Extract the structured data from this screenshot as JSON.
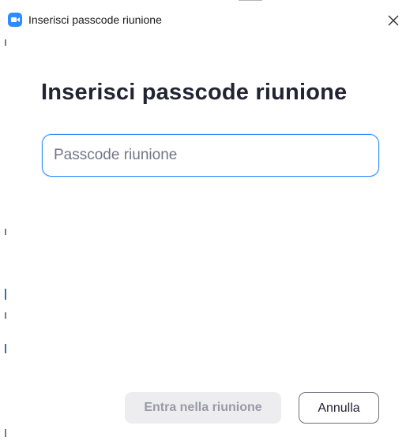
{
  "window": {
    "title": "Inserisci passcode riunione",
    "close_icon": "close-icon",
    "app_icon": "zoom-app-icon",
    "accent_color": "#2d8cff"
  },
  "main": {
    "heading": "Inserisci passcode riunione",
    "passcode_input": {
      "value": "",
      "placeholder": "Passcode riunione"
    }
  },
  "footer": {
    "join_label": "Entra nella riunione",
    "join_enabled": false,
    "cancel_label": "Annulla"
  }
}
